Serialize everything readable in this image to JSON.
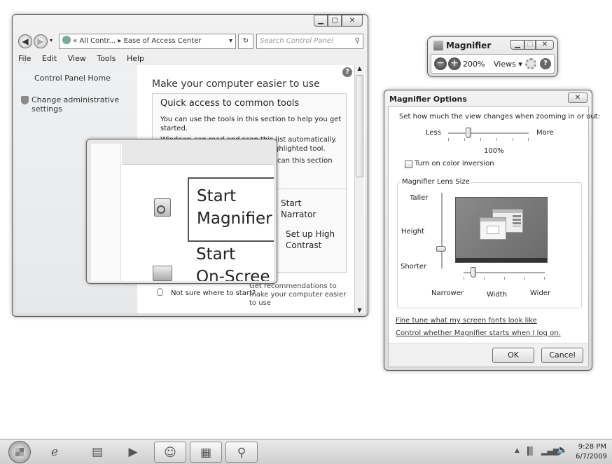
{
  "control_panel": {
    "address": {
      "overflow": "«",
      "crumb1": "All Contr...",
      "sep": "▸",
      "crumb2": "Ease of Access Center"
    },
    "search_placeholder": "Search Control Panel",
    "menu": [
      "File",
      "Edit",
      "View",
      "Tools",
      "Help"
    ],
    "left_nav": {
      "home": "Control Panel Home",
      "admin": "Change administrative settings"
    },
    "heading": "Make your computer easier to use",
    "quick_access": {
      "title": "Quick access to common tools",
      "p1": "You can use the tools in this section to help you get started.",
      "p2a": "Windows can read and scan this list automatically.",
      "p2b": "ghlighted tool.",
      "p2c": "can this section"
    },
    "tools": {
      "narrator": "Start Narrator",
      "high_contrast": "Set up High Contrast"
    },
    "recommend": {
      "question": "Not sure where to start?",
      "link": "Get recommendations to make your computer easier to use"
    }
  },
  "magnifier_lens": {
    "magnifier_line1": "Start",
    "magnifier_line2": "Magnifier",
    "onscreen_line1": "Start",
    "onscreen_line2": "On-Scree"
  },
  "magnifier_toolbar": {
    "title": "Magnifier",
    "zoom": "200%",
    "views": "Views ▾"
  },
  "magnifier_options": {
    "title": "Magnifier Options",
    "prompt": "Set how much the view changes when zooming in or out:",
    "less": "Less",
    "more": "More",
    "zoom_value": "100%",
    "zoom_level": 0.25,
    "color_inversion_label": "Turn on color inversion",
    "color_inversion_checked": false,
    "lens_group": "Magnifier Lens Size",
    "taller": "Taller",
    "height": "Height",
    "shorter": "Shorter",
    "narrower": "Narrower",
    "width": "Width",
    "wider": "Wider",
    "link1": "Fine tune what my screen fonts look like",
    "link2": "Control whether Magnifier starts when I log on.",
    "ok": "OK",
    "cancel": "Cancel"
  },
  "taskbar": {
    "time": "9:28 PM",
    "date": "6/7/2009"
  }
}
